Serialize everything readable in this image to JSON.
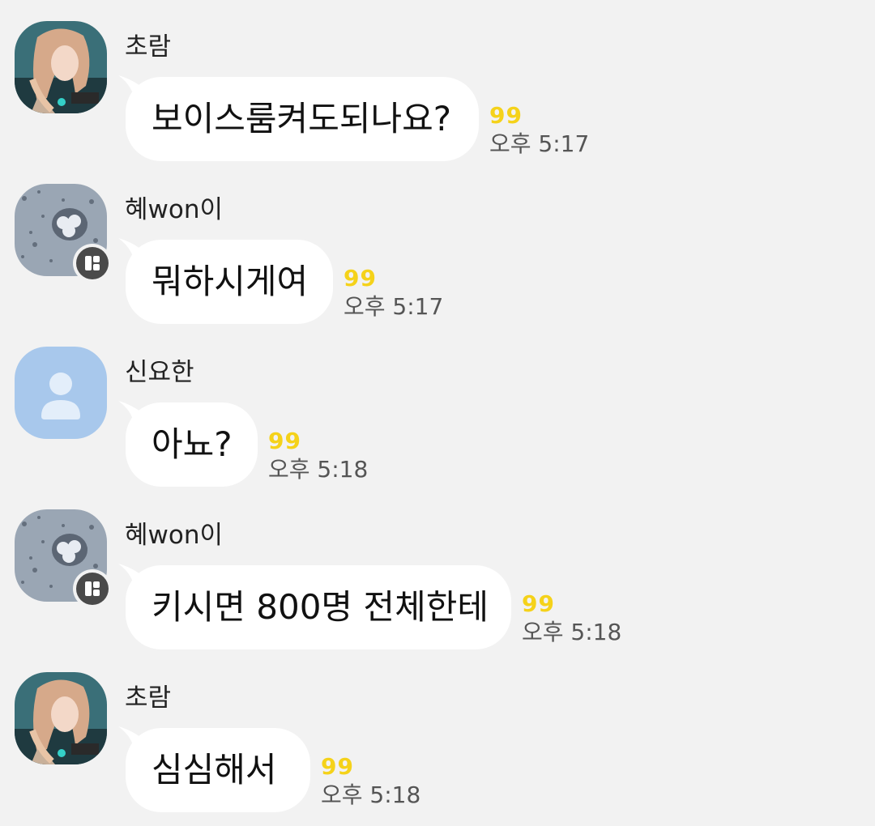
{
  "messages": [
    {
      "sender": "초람",
      "text": "보이스룸켜도되나요?",
      "unread": "99",
      "time": "오후 5:17",
      "avatar": "anime-character-avatar",
      "badge": false
    },
    {
      "sender": "혜won이",
      "text": "뭐하시게여",
      "unread": "99",
      "time": "오후 5:17",
      "avatar": "snow-photo-avatar",
      "badge": true
    },
    {
      "sender": "신요한",
      "text": "아뇨?",
      "unread": "99",
      "time": "오후 5:18",
      "avatar": "default-person-avatar",
      "badge": false
    },
    {
      "sender": "혜won이",
      "text": "키시면 800명 전체한테",
      "unread": "99",
      "time": "오후 5:18",
      "avatar": "snow-photo-avatar",
      "badge": true
    },
    {
      "sender": "초람",
      "text": "심심해서",
      "unread": "99",
      "time": "오후 5:18",
      "avatar": "anime-character-avatar",
      "badge": false
    }
  ],
  "colors": {
    "background": "#f2f2f2",
    "bubble": "#ffffff",
    "unread": "#f5d21a",
    "default_avatar": "#a8c8ec",
    "badge": "#4a4a4a"
  }
}
